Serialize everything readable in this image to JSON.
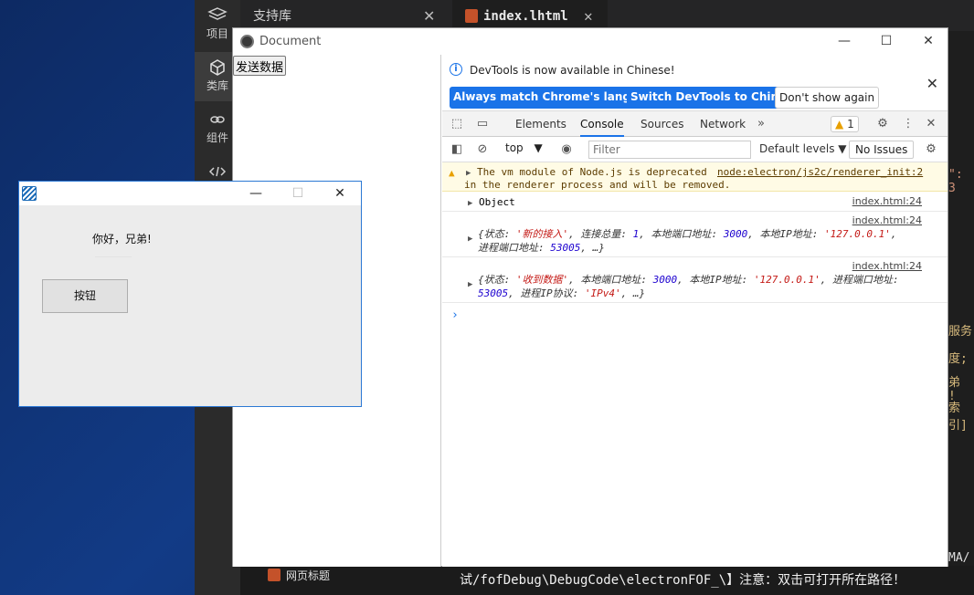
{
  "ide": {
    "sidebar": [
      {
        "label": "项目",
        "icon": "layers-icon"
      },
      {
        "label": "类库",
        "icon": "cube-icon"
      },
      {
        "label": "组件",
        "icon": "link-icon"
      },
      {
        "label": "",
        "icon": "code-icon"
      }
    ],
    "tabs": [
      {
        "label": "支持库"
      },
      {
        "label": "index.lhtml"
      }
    ],
    "tree_item": "网页标题",
    "console_line": "试/fofDebug\\DebugCode\\electronFOF_\\】注意：双击可打开所在路径！",
    "code_fragments": [
      "\": 3",
      "服务",
      "度;",
      "弟 !",
      "索引]",
      "MA/"
    ]
  },
  "document_window": {
    "title": "Document",
    "send_button": "发送数据",
    "window_buttons": {
      "minimize": "—",
      "maximize": "☐",
      "close": "✕"
    }
  },
  "devtools": {
    "info_text": "DevTools is now available in Chinese!",
    "btn_match": "Always match Chrome's language",
    "btn_switch": "Switch DevTools to Chinese",
    "btn_dont_show": "Don't show again",
    "tabs": [
      "Elements",
      "Console",
      "Sources",
      "Network"
    ],
    "active_tab": "Console",
    "warning_count": "1",
    "context": "top",
    "filter_placeholder": "Filter",
    "levels": "Default levels",
    "issues": "No Issues",
    "messages": {
      "warn_line1": "The vm module of Node.js is deprecated",
      "warn_link": "node:electron/js2c/renderer_init:2",
      "warn_line2": "in the renderer process and will be removed.",
      "src": "index.html:24",
      "object_label": "Object",
      "m2_part1": "{状态: ",
      "m2_state": "'新的接入'",
      "m2_part2": ", 连接总量: ",
      "m2_total": "1",
      "m2_part3": ", 本地端口地址: ",
      "m2_port": "3000",
      "m2_part4": ", 本地IP地址: ",
      "m2_ip": "'127.0.0.1'",
      "m2_part5": ",",
      "m2_part6": "进程端口地址: ",
      "m2_rport": "53005",
      "m2_part7": ", …}",
      "m3_part1": "{状态: ",
      "m3_state": "'收到数据'",
      "m3_part2": ", 本地端口地址: ",
      "m3_port": "3000",
      "m3_part3": ", 本地IP地址: ",
      "m3_ip": "'127.0.0.1'",
      "m3_part4": ", 进程端口地址:",
      "m3_rport": "53005",
      "m3_part5": ", 进程IP协议: ",
      "m3_proto": "'IPv4'",
      "m3_part6": ", …}",
      "prompt": "›"
    }
  },
  "native_window": {
    "greeting": "你好，兄弟!",
    "button": "按钮"
  },
  "colors": {
    "desktop": "#123b86",
    "accent": "#1a73e8",
    "warning": "#e8a000"
  }
}
